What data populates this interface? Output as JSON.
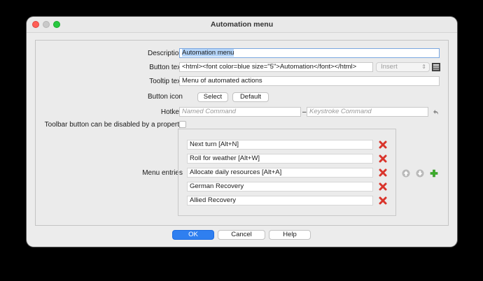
{
  "window": {
    "title": "Automation menu"
  },
  "form": {
    "description": {
      "label": "Description",
      "value": "Automation menu"
    },
    "button_text": {
      "label": "Button text",
      "value": "<html><font color=blue size=\"5\">Automation</font></html>",
      "select_value": "Insert"
    },
    "tooltip": {
      "label": "Tooltip text",
      "value": "Menu of automated actions"
    },
    "button_icon": {
      "label": "Button icon",
      "select_label": "Select",
      "default_label": "Default"
    },
    "hotkey": {
      "label": "Hotkey",
      "named_placeholder": "Named Command",
      "separator": "–",
      "keystroke_placeholder": "Keystroke Command"
    },
    "toolbar_disable": {
      "label": "Toolbar button can be disabled by a property",
      "checked": false
    },
    "menu_entries": {
      "label": "Menu entries",
      "items": [
        {
          "text": "Next turn   [Alt+N]"
        },
        {
          "text": "Roll for weather   [Alt+W]"
        },
        {
          "text": "Allocate daily resources   [Alt+A]"
        },
        {
          "text": "German Recovery"
        },
        {
          "text": "Allied Recovery"
        }
      ]
    }
  },
  "footer": {
    "ok": "OK",
    "cancel": "Cancel",
    "help": "Help"
  },
  "colors": {
    "accent": "#2f7ff0",
    "delete": "#d9342b",
    "add": "#3cae2a"
  }
}
